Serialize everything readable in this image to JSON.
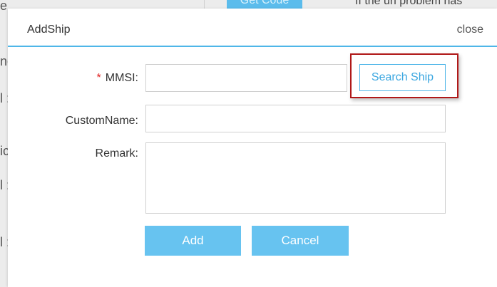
{
  "background": {
    "top_button_label": "Get Code",
    "top_text": "If the url problem has",
    "edge_fragments": [
      "e :",
      "ne",
      "l :",
      "ic",
      "l :",
      "l :"
    ]
  },
  "modal": {
    "title": "AddShip",
    "close_label": "close",
    "form": {
      "mmsi": {
        "required_mark": "*",
        "label": "MMSI:",
        "value": ""
      },
      "search_button_label": "Search Ship",
      "custom_name": {
        "label": "CustomName:",
        "value": ""
      },
      "remark": {
        "label": "Remark:",
        "value": ""
      }
    },
    "buttons": {
      "add_label": "Add",
      "cancel_label": "Cancel"
    }
  },
  "colors": {
    "accent": "#4fb6e8",
    "button_fill": "#67c3f0",
    "required": "#e01e1e",
    "highlight_border": "#b01818"
  }
}
